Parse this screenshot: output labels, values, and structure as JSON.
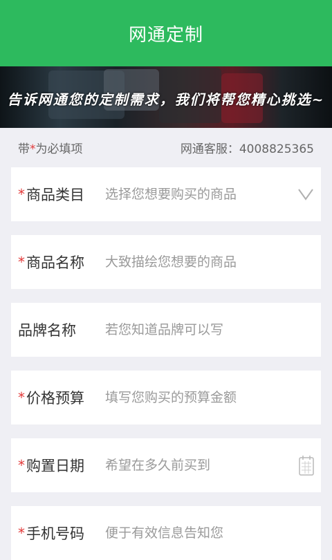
{
  "header": {
    "title": "网通定制"
  },
  "banner": {
    "slogan": "告诉网通您的定制需求，我们将帮您精心挑选~"
  },
  "notice": {
    "prefix": "带",
    "star": "*",
    "suffix": "为必填项",
    "hotline": "网通客服：4008825365"
  },
  "form": {
    "fields": [
      {
        "label": "商品类目",
        "required": true,
        "placeholder": "选择您想要购买的商品",
        "icon": "chevron-down-icon"
      },
      {
        "label": "商品名称",
        "required": true,
        "placeholder": "大致描绘您想要的商品"
      },
      {
        "label": "品牌名称",
        "required": false,
        "placeholder": "若您知道品牌可以写"
      },
      {
        "label": "价格预算",
        "required": true,
        "placeholder": "填写您购买的预算金额"
      },
      {
        "label": "购置日期",
        "required": true,
        "placeholder": "希望在多久前买到",
        "icon": "calendar-icon"
      },
      {
        "label": "手机号码",
        "required": true,
        "placeholder": "便于有效信息告知您"
      }
    ],
    "required_mark": "*"
  },
  "colors": {
    "brand": "#2dba5e",
    "required": "#e23a3a",
    "background": "#efeff4"
  }
}
